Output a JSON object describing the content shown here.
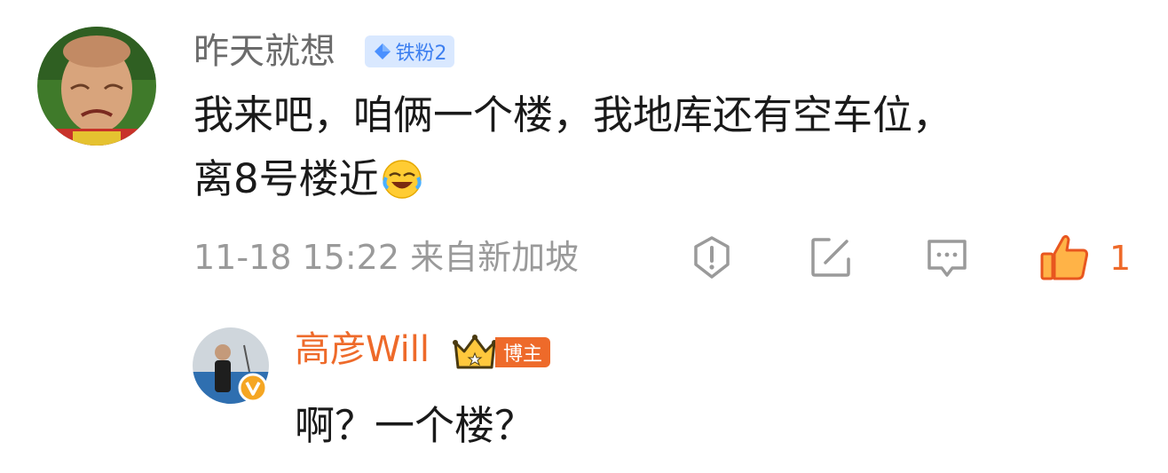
{
  "comment": {
    "username": "昨天就想",
    "fan_badge": "铁粉2",
    "text_line1": "我来吧，咱俩一个楼，我地库还有空车位，",
    "text_line2": "离8号楼近",
    "emoji": "laughing-crying-emoji",
    "meta": "11-18 15:22 来自新加坡",
    "like_count": "1",
    "actions": [
      "report-icon",
      "share-icon",
      "reply-icon",
      "like-icon"
    ]
  },
  "reply": {
    "username": "高彦Will",
    "role_badge": "博主",
    "text": "啊？一个楼？"
  },
  "colors": {
    "accent_orange": "#ee6a2a",
    "fan_badge_bg": "#d9e8ff",
    "fan_badge_text": "#3d7ff0",
    "meta_gray": "#9a9a9a"
  }
}
